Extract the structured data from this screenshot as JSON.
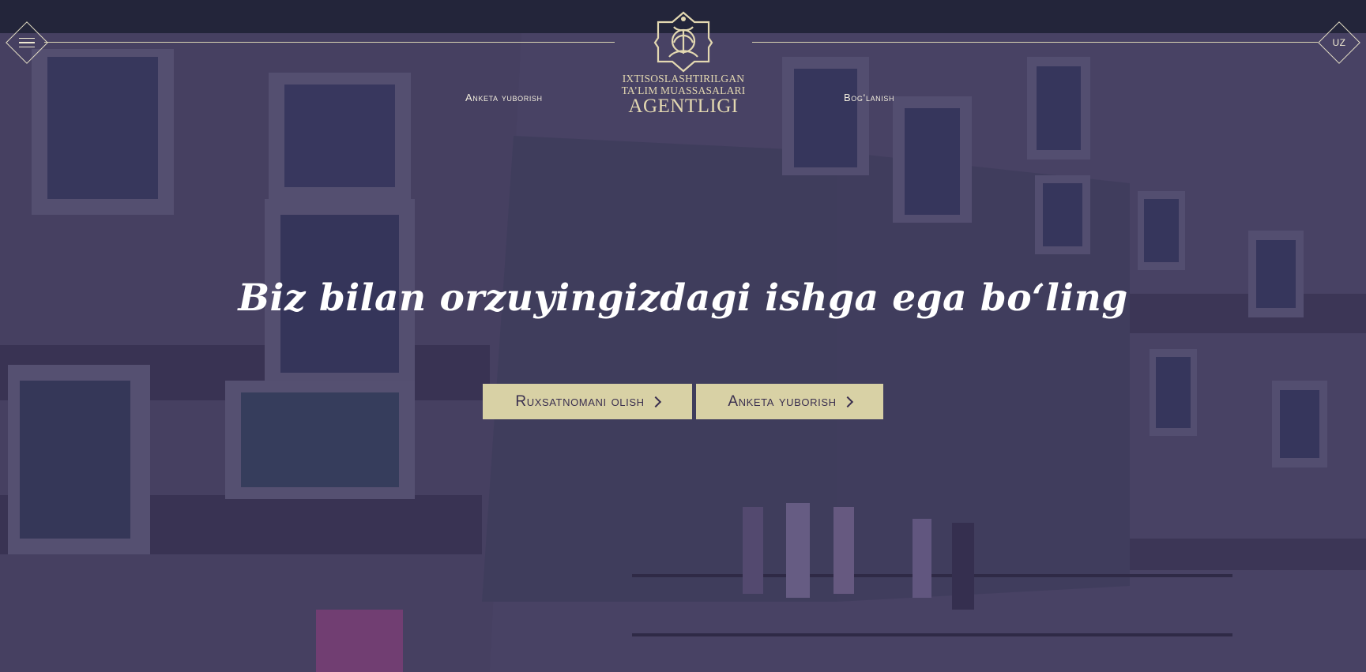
{
  "header": {
    "menu_icon": "hamburger-icon",
    "language": "UZ",
    "nav_left": "Anketa yuborish",
    "nav_right": "Bog‘lanish"
  },
  "logo": {
    "line1": "IXTISOSLASHTIRILGAN",
    "line2": "TA’LIM MUASSASALARI",
    "line3": "AGENTLIGI"
  },
  "hero": {
    "headline": "Biz bilan orzuyingizdagi ishga ega bo‘ling",
    "buttons": [
      {
        "label": "Ruxsatnomani olish"
      },
      {
        "label": "Anketa yuborish"
      }
    ]
  },
  "colors": {
    "topbar": "#23253a",
    "accent": "#d8d1a5",
    "text_light": "#f3eede",
    "logo_gold": "#e3d8b1"
  }
}
